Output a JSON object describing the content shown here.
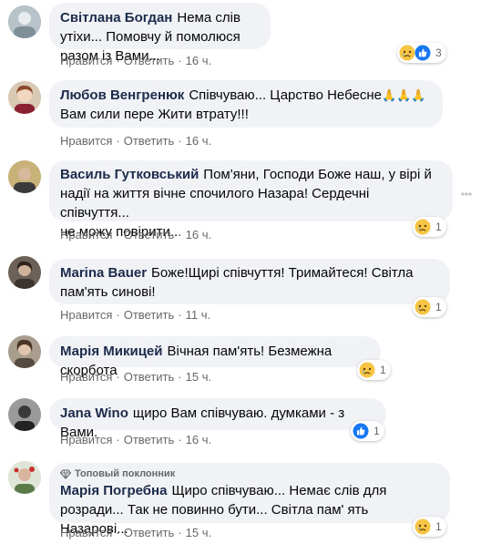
{
  "actions": {
    "like": "Нравится",
    "reply": "Ответить",
    "separator": "·"
  },
  "comments": [
    {
      "author": "Світлана Богдан",
      "text1": "Нема слів утіхи... Помовчу й помолюся",
      "text2": "разом із Вами...",
      "time": "16 ч.",
      "reaction_count": "3",
      "reactions": [
        "sad-emoji",
        "like-emoji"
      ]
    },
    {
      "author": "Любов Венгренюк",
      "text1": "Співчуваю... Царство Небесне",
      "emoji": "🙏🙏🙏",
      "text2": "Вам сили пере Жити втрату!!!",
      "time": "16 ч."
    },
    {
      "author": "Василь Гутковський",
      "text1": "Пом'яни, Господи Боже наш, у вірі й",
      "text2": "надії на життя вічне спочилого Назара! Сердечні співчуття...",
      "text3": "не можу повірити...",
      "time": "16 ч.",
      "reaction_count": "1",
      "reactions": [
        "sad-emoji"
      ]
    },
    {
      "author": "Marina Bauer",
      "text1": "Боже!Щирі співчуття! Тримайтеся! Світла",
      "text2": "пам'ять синові!",
      "time": "11 ч.",
      "reaction_count": "1",
      "reactions": [
        "sad-emoji"
      ]
    },
    {
      "author": "Марія Микицей",
      "text1": "Вічная пам'ять! Безмежна скорбота",
      "time": "15 ч.",
      "reaction_count": "1",
      "reactions": [
        "sad-emoji"
      ]
    },
    {
      "author": "Jana Wino",
      "text1": "щиро Вам співчуваю. думками - з Вами.",
      "time": "16 ч.",
      "reaction_count": "1",
      "reactions": [
        "like-emoji"
      ]
    },
    {
      "badge": "Топовый поклонник",
      "author": "Марія Погребна",
      "text1": "Щиро співчуваю... Немає слів для",
      "text2": "розради... Так не повинно бути... Світла пам' ять Назарові...",
      "time": "15 ч.",
      "reaction_count": "1",
      "reactions": [
        "sad-emoji"
      ]
    }
  ],
  "colors": {
    "bubble": "#f0f2f5",
    "author": "#1c2b4a",
    "meta": "#65676b",
    "like_blue": "#1877f2",
    "sad_yellow": "#f7c544"
  }
}
